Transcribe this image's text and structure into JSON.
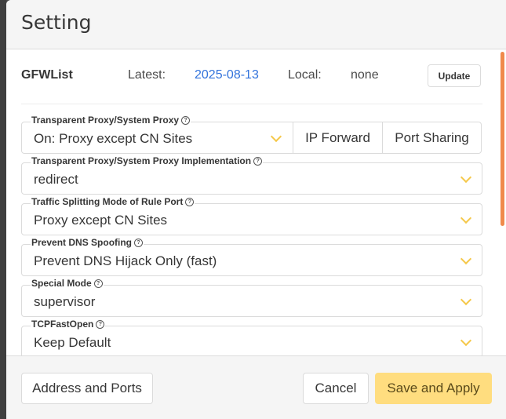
{
  "modal": {
    "title": "Setting"
  },
  "gfwlist": {
    "title": "GFWList",
    "latest_label": "Latest:",
    "latest_value": "2025-08-13",
    "local_label": "Local:",
    "local_value": "none",
    "update_label": "Update"
  },
  "fields": [
    {
      "label": "Transparent Proxy/System Proxy",
      "value": "On: Proxy except CN Sites"
    },
    {
      "label": "Transparent Proxy/System Proxy Implementation",
      "value": "redirect"
    },
    {
      "label": "Traffic Splitting Mode of Rule Port",
      "value": "Proxy except CN Sites"
    },
    {
      "label": "Prevent DNS Spoofing",
      "value": "Prevent DNS Hijack Only (fast)"
    },
    {
      "label": "Special Mode",
      "value": "supervisor"
    },
    {
      "label": "TCPFastOpen",
      "value": "Keep Default"
    }
  ],
  "addons": {
    "ip_forward": "IP Forward",
    "port_sharing": "Port Sharing"
  },
  "footer": {
    "address_ports": "Address and Ports",
    "cancel": "Cancel",
    "save_apply": "Save and Apply"
  },
  "colors": {
    "accent": "#f5c84a",
    "link": "#3273dc",
    "primary_button": "#ffdd7f",
    "scrollbar": "#f08a4b"
  },
  "icons": {
    "help": "question-circle-icon",
    "select": "chevron-down-icon"
  }
}
